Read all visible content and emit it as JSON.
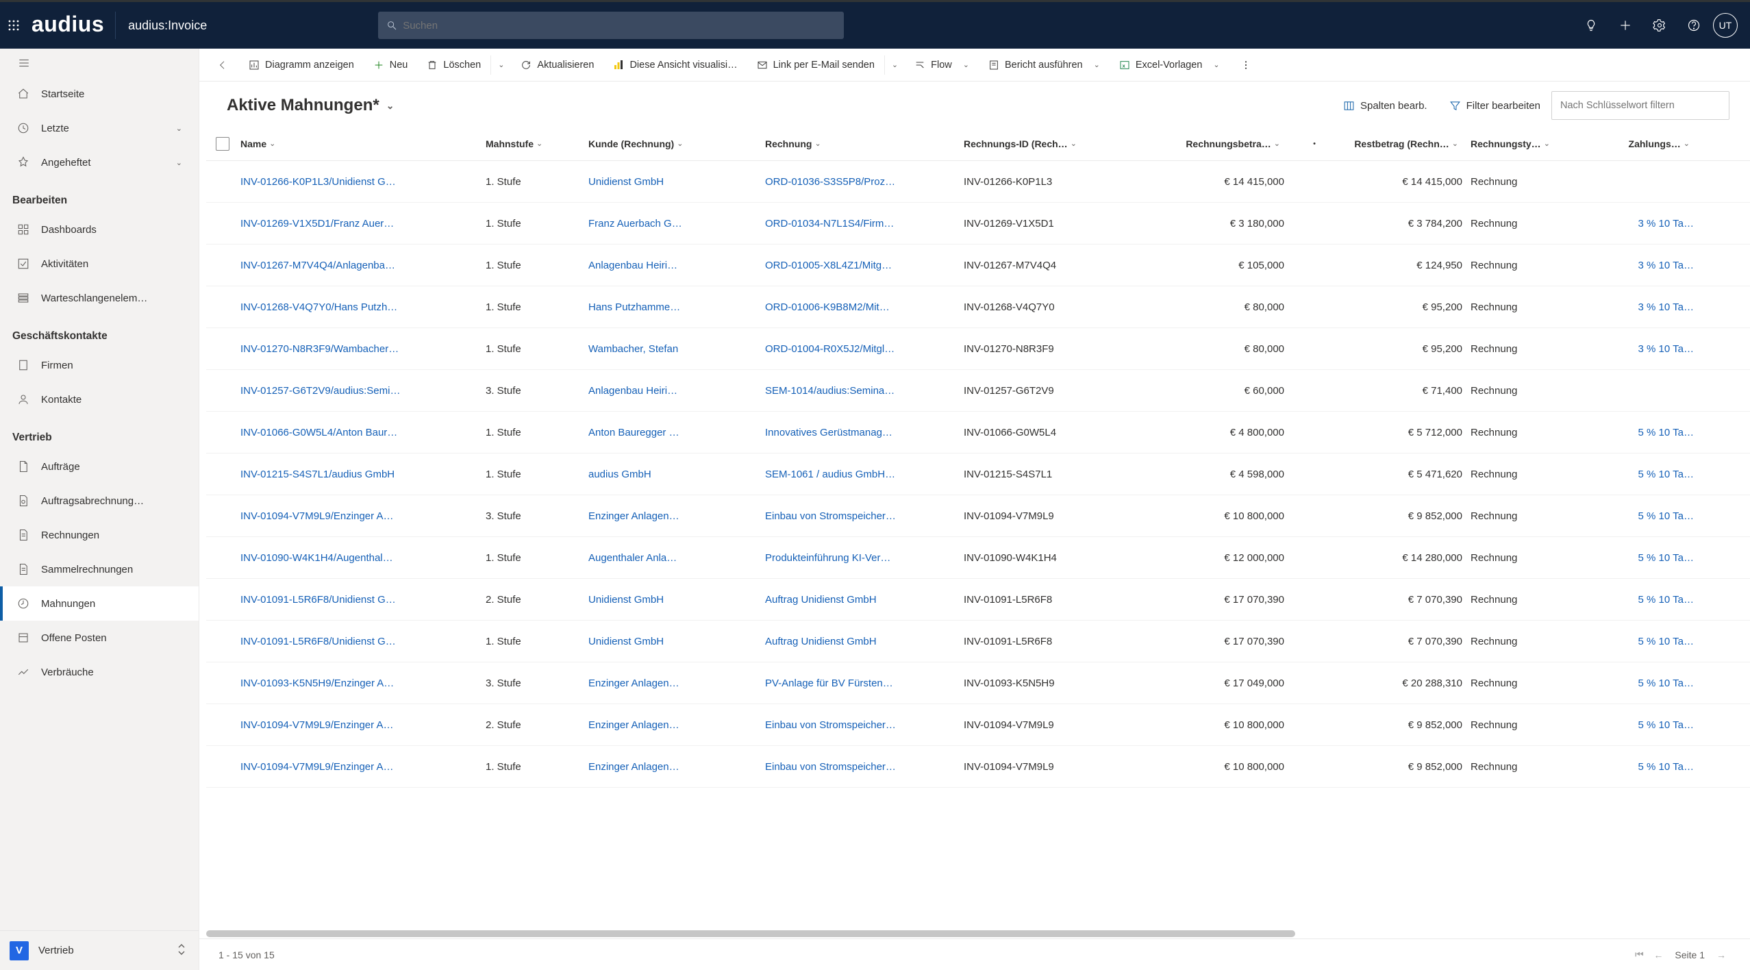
{
  "header": {
    "brand": "audius",
    "app_name": "audius:Invoice",
    "search_placeholder": "Suchen",
    "avatar": "UT"
  },
  "sidebar": {
    "top": [
      {
        "icon": "home",
        "label": "Startseite",
        "chev": false
      },
      {
        "icon": "clock",
        "label": "Letzte",
        "chev": true
      },
      {
        "icon": "pin",
        "label": "Angeheftet",
        "chev": true
      }
    ],
    "groups": [
      {
        "title": "Bearbeiten",
        "items": [
          {
            "icon": "dash",
            "label": "Dashboards"
          },
          {
            "icon": "check",
            "label": "Aktivitäten"
          },
          {
            "icon": "queue",
            "label": "Warteschlangenelem…"
          }
        ]
      },
      {
        "title": "Geschäftskontakte",
        "items": [
          {
            "icon": "building",
            "label": "Firmen"
          },
          {
            "icon": "person",
            "label": "Kontakte"
          }
        ]
      },
      {
        "title": "Vertrieb",
        "items": [
          {
            "icon": "doc",
            "label": "Aufträge"
          },
          {
            "icon": "docgear",
            "label": "Auftragsabrechnung…"
          },
          {
            "icon": "invoice",
            "label": "Rechnungen"
          },
          {
            "icon": "invoice",
            "label": "Sammelrechnungen"
          },
          {
            "icon": "mahn",
            "label": "Mahnungen",
            "active": true
          },
          {
            "icon": "open",
            "label": "Offene Posten"
          },
          {
            "icon": "usage",
            "label": "Verbräuche"
          }
        ]
      }
    ],
    "footer": {
      "initial": "V",
      "label": "Vertrieb"
    }
  },
  "commandbar": {
    "chart": "Diagramm anzeigen",
    "new": "Neu",
    "delete": "Löschen",
    "refresh": "Aktualisieren",
    "visualize": "Diese Ansicht visualisi…",
    "email": "Link per E-Mail senden",
    "flow": "Flow",
    "report": "Bericht ausführen",
    "excel": "Excel-Vorlagen"
  },
  "view": {
    "title": "Aktive Mahnungen*",
    "edit_cols": "Spalten bearb.",
    "edit_filter": "Filter bearbeiten",
    "search_placeholder": "Nach Schlüsselwort filtern"
  },
  "table": {
    "columns": [
      "Name",
      "Mahnstufe",
      "Kunde (Rechnung)",
      "Rechnung",
      "Rechnungs-ID (Rech…",
      "Rechnungsbetra…",
      "Restbetrag (Rechn…",
      "Rechnungsty…",
      "Zahlungs…"
    ],
    "rows": [
      {
        "name": "INV-01266-K0P1L3/Unidienst G…",
        "stufe": "1. Stufe",
        "kunde": "Unidienst GmbH",
        "rechnung": "ORD-01036-S3S5P8/Proz…",
        "rid": "INV-01266-K0P1L3",
        "betrag": "€ 14 415,000",
        "rest": "€ 14 415,000",
        "typ": "Rechnung",
        "zahl": ""
      },
      {
        "name": "INV-01269-V1X5D1/Franz Auer…",
        "stufe": "1. Stufe",
        "kunde": "Franz Auerbach G…",
        "rechnung": "ORD-01034-N7L1S4/Firm…",
        "rid": "INV-01269-V1X5D1",
        "betrag": "€ 3 180,000",
        "rest": "€ 3 784,200",
        "typ": "Rechnung",
        "zahl": "3 % 10 Ta…"
      },
      {
        "name": "INV-01267-M7V4Q4/Anlagenba…",
        "stufe": "1. Stufe",
        "kunde": "Anlagenbau Heiri…",
        "rechnung": "ORD-01005-X8L4Z1/Mitg…",
        "rid": "INV-01267-M7V4Q4",
        "betrag": "€ 105,000",
        "rest": "€ 124,950",
        "typ": "Rechnung",
        "zahl": "3 % 10 Ta…"
      },
      {
        "name": "INV-01268-V4Q7Y0/Hans Putzh…",
        "stufe": "1. Stufe",
        "kunde": "Hans Putzhamme…",
        "rechnung": "ORD-01006-K9B8M2/Mit…",
        "rid": "INV-01268-V4Q7Y0",
        "betrag": "€ 80,000",
        "rest": "€ 95,200",
        "typ": "Rechnung",
        "zahl": "3 % 10 Ta…"
      },
      {
        "name": "INV-01270-N8R3F9/Wambacher…",
        "stufe": "1. Stufe",
        "kunde": "Wambacher, Stefan",
        "rechnung": "ORD-01004-R0X5J2/Mitgl…",
        "rid": "INV-01270-N8R3F9",
        "betrag": "€ 80,000",
        "rest": "€ 95,200",
        "typ": "Rechnung",
        "zahl": "3 % 10 Ta…"
      },
      {
        "name": "INV-01257-G6T2V9/audius:Semi…",
        "stufe": "3. Stufe",
        "kunde": "Anlagenbau Heiri…",
        "rechnung": "SEM-1014/audius:Semina…",
        "rid": "INV-01257-G6T2V9",
        "betrag": "€ 60,000",
        "rest": "€ 71,400",
        "typ": "Rechnung",
        "zahl": ""
      },
      {
        "name": "INV-01066-G0W5L4/Anton Baur…",
        "stufe": "1. Stufe",
        "kunde": "Anton Bauregger …",
        "rechnung": "Innovatives Gerüstmanag…",
        "rid": "INV-01066-G0W5L4",
        "betrag": "€ 4 800,000",
        "rest": "€ 5 712,000",
        "typ": "Rechnung",
        "zahl": "5 % 10 Ta…"
      },
      {
        "name": "INV-01215-S4S7L1/audius GmbH",
        "stufe": "1. Stufe",
        "kunde": "audius GmbH",
        "rechnung": "SEM-1061 / audius GmbH…",
        "rid": "INV-01215-S4S7L1",
        "betrag": "€ 4 598,000",
        "rest": "€ 5 471,620",
        "typ": "Rechnung",
        "zahl": "5 % 10 Ta…"
      },
      {
        "name": "INV-01094-V7M9L9/Enzinger A…",
        "stufe": "3. Stufe",
        "kunde": "Enzinger Anlagen…",
        "rechnung": "Einbau von Stromspeicher…",
        "rid": "INV-01094-V7M9L9",
        "betrag": "€ 10 800,000",
        "rest": "€ 9 852,000",
        "typ": "Rechnung",
        "zahl": "5 % 10 Ta…"
      },
      {
        "name": "INV-01090-W4K1H4/Augenthal…",
        "stufe": "1. Stufe",
        "kunde": "Augenthaler Anla…",
        "rechnung": "Produkteinführung KI-Ver…",
        "rid": "INV-01090-W4K1H4",
        "betrag": "€ 12 000,000",
        "rest": "€ 14 280,000",
        "typ": "Rechnung",
        "zahl": "5 % 10 Ta…"
      },
      {
        "name": "INV-01091-L5R6F8/Unidienst G…",
        "stufe": "2. Stufe",
        "kunde": "Unidienst GmbH",
        "rechnung": "Auftrag Unidienst GmbH",
        "rid": "INV-01091-L5R6F8",
        "betrag": "€ 17 070,390",
        "rest": "€ 7 070,390",
        "typ": "Rechnung",
        "zahl": "5 % 10 Ta…"
      },
      {
        "name": "INV-01091-L5R6F8/Unidienst G…",
        "stufe": "1. Stufe",
        "kunde": "Unidienst GmbH",
        "rechnung": "Auftrag Unidienst GmbH",
        "rid": "INV-01091-L5R6F8",
        "betrag": "€ 17 070,390",
        "rest": "€ 7 070,390",
        "typ": "Rechnung",
        "zahl": "5 % 10 Ta…"
      },
      {
        "name": "INV-01093-K5N5H9/Enzinger A…",
        "stufe": "3. Stufe",
        "kunde": "Enzinger Anlagen…",
        "rechnung": "PV-Anlage für BV Fürsten…",
        "rid": "INV-01093-K5N5H9",
        "betrag": "€ 17 049,000",
        "rest": "€ 20 288,310",
        "typ": "Rechnung",
        "zahl": "5 % 10 Ta…"
      },
      {
        "name": "INV-01094-V7M9L9/Enzinger A…",
        "stufe": "2. Stufe",
        "kunde": "Enzinger Anlagen…",
        "rechnung": "Einbau von Stromspeicher…",
        "rid": "INV-01094-V7M9L9",
        "betrag": "€ 10 800,000",
        "rest": "€ 9 852,000",
        "typ": "Rechnung",
        "zahl": "5 % 10 Ta…"
      },
      {
        "name": "INV-01094-V7M9L9/Enzinger A…",
        "stufe": "1. Stufe",
        "kunde": "Enzinger Anlagen…",
        "rechnung": "Einbau von Stromspeicher…",
        "rid": "INV-01094-V7M9L9",
        "betrag": "€ 10 800,000",
        "rest": "€ 9 852,000",
        "typ": "Rechnung",
        "zahl": "5 % 10 Ta…"
      }
    ]
  },
  "footer": {
    "range": "1 - 15 von 15",
    "page": "Seite 1"
  }
}
